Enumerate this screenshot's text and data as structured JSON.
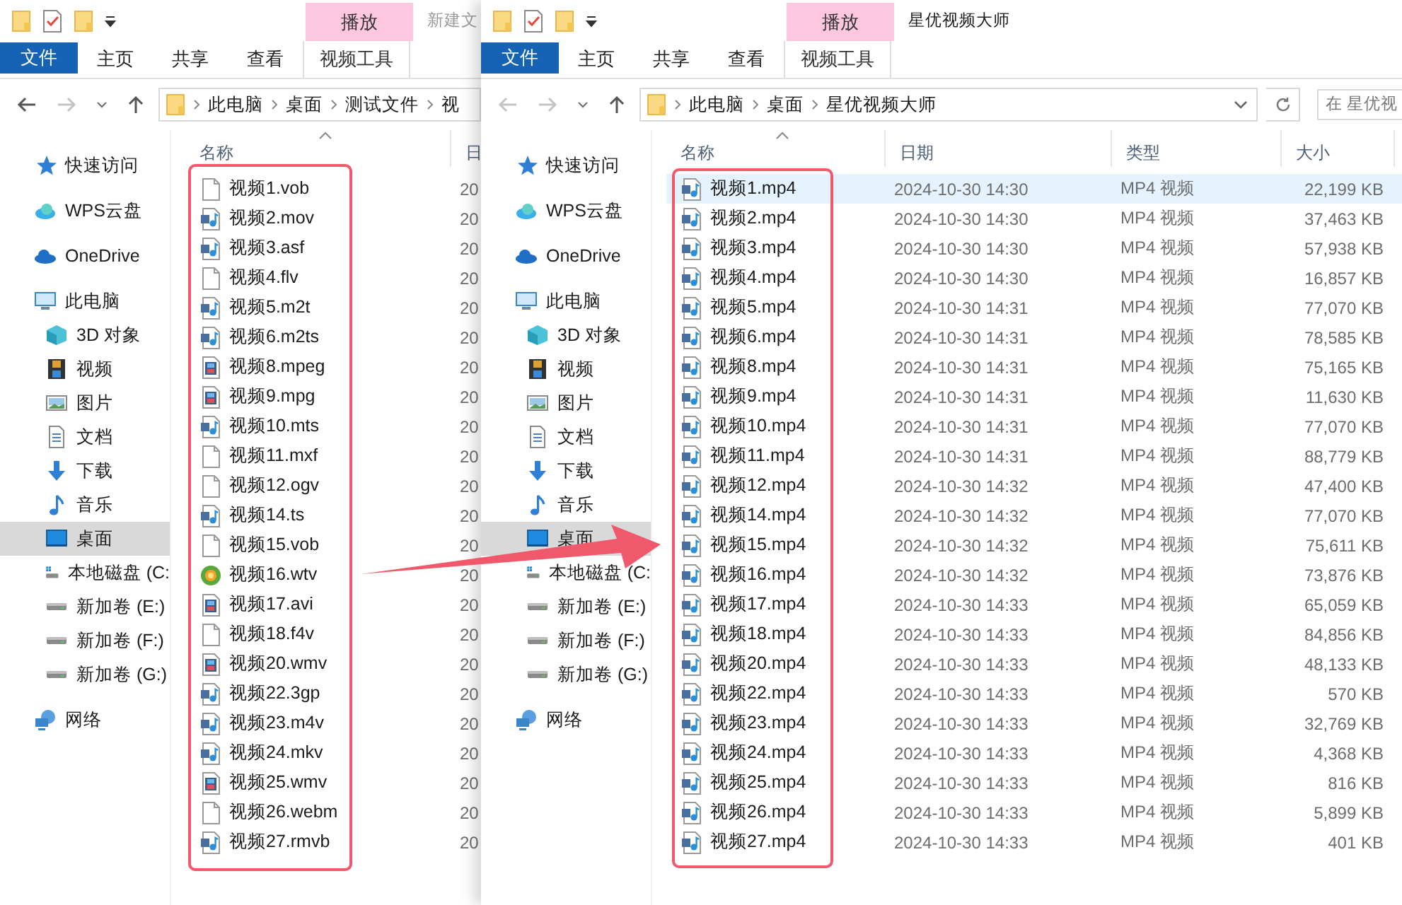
{
  "windows": [
    {
      "title": "新建文",
      "active": false,
      "context_tab": "播放",
      "ribbon_tabs": [
        {
          "label": "文件",
          "kind": "file"
        },
        {
          "label": "主页",
          "kind": "tab"
        },
        {
          "label": "共享",
          "kind": "tab"
        },
        {
          "label": "查看",
          "kind": "tab"
        },
        {
          "label": "视频工具",
          "kind": "context"
        }
      ],
      "nav_buttons": [
        {
          "kind": "back",
          "disabled": false
        },
        {
          "kind": "forward",
          "disabled": true
        },
        {
          "kind": "recent",
          "disabled": false
        },
        {
          "kind": "up",
          "disabled": false
        }
      ],
      "address": [
        "此电脑",
        "桌面",
        "测试文件",
        "视"
      ],
      "columns": [
        {
          "label": "名称",
          "kind": "name",
          "sorted": true
        },
        {
          "label": "日",
          "kind": "date",
          "sorted": false
        }
      ],
      "nav": [
        {
          "label": "快速访问",
          "kind": "star",
          "selected": false
        },
        {
          "label": "WPS云盘",
          "kind": "wps",
          "selected": false
        },
        {
          "label": "OneDrive",
          "kind": "onedrive",
          "selected": false
        },
        {
          "label": "此电脑",
          "kind": "pc",
          "selected": false,
          "children": [
            {
              "label": "3D 对象",
              "kind": "cube",
              "selected": false
            },
            {
              "label": "视频",
              "kind": "film",
              "selected": false
            },
            {
              "label": "图片",
              "kind": "picture",
              "selected": false
            },
            {
              "label": "文档",
              "kind": "doc",
              "selected": false
            },
            {
              "label": "下载",
              "kind": "download",
              "selected": false
            },
            {
              "label": "音乐",
              "kind": "music",
              "selected": false
            },
            {
              "label": "桌面",
              "kind": "desktop",
              "selected": true
            },
            {
              "label": "本地磁盘 (C:",
              "kind": "windrive",
              "selected": false
            },
            {
              "label": "新加卷 (E:)",
              "kind": "drive",
              "selected": false
            },
            {
              "label": "新加卷 (F:)",
              "kind": "drive",
              "selected": false
            },
            {
              "label": "新加卷 (G:)",
              "kind": "drive",
              "selected": false
            }
          ]
        },
        {
          "label": "网络",
          "kind": "network",
          "selected": false
        }
      ],
      "files": [
        {
          "name": "视频1.vob",
          "kind": "blank",
          "selected": false,
          "date": "20"
        },
        {
          "name": "视频2.mov",
          "kind": "media",
          "selected": false,
          "date": "20"
        },
        {
          "name": "视频3.asf",
          "kind": "media",
          "selected": false,
          "date": "20"
        },
        {
          "name": "视频4.flv",
          "kind": "blank",
          "selected": false,
          "date": "20"
        },
        {
          "name": "视频5.m2t",
          "kind": "media",
          "selected": false,
          "date": "20"
        },
        {
          "name": "视频6.m2ts",
          "kind": "media",
          "selected": false,
          "date": "20"
        },
        {
          "name": "视频8.mpeg",
          "kind": "film",
          "selected": false,
          "date": "20"
        },
        {
          "name": "视频9.mpg",
          "kind": "film",
          "selected": false,
          "date": "20"
        },
        {
          "name": "视频10.mts",
          "kind": "media",
          "selected": false,
          "date": "20"
        },
        {
          "name": "视频11.mxf",
          "kind": "blank",
          "selected": false,
          "date": "20"
        },
        {
          "name": "视频12.ogv",
          "kind": "blank",
          "selected": false,
          "date": "20"
        },
        {
          "name": "视频14.ts",
          "kind": "media",
          "selected": false,
          "date": "20"
        },
        {
          "name": "视频15.vob",
          "kind": "blank",
          "selected": false,
          "date": "20"
        },
        {
          "name": "视频16.wtv",
          "kind": "orb",
          "selected": false,
          "date": "20"
        },
        {
          "name": "视频17.avi",
          "kind": "film",
          "selected": false,
          "date": "20"
        },
        {
          "name": "视频18.f4v",
          "kind": "blank",
          "selected": false,
          "date": "20"
        },
        {
          "name": "视频20.wmv",
          "kind": "film",
          "selected": false,
          "date": "20"
        },
        {
          "name": "视频22.3gp",
          "kind": "media",
          "selected": false,
          "date": "20"
        },
        {
          "name": "视频23.m4v",
          "kind": "media",
          "selected": false,
          "date": "20"
        },
        {
          "name": "视频24.mkv",
          "kind": "media",
          "selected": false,
          "date": "20"
        },
        {
          "name": "视频25.wmv",
          "kind": "film",
          "selected": false,
          "date": "20"
        },
        {
          "name": "视频26.webm",
          "kind": "blank",
          "selected": false,
          "date": "20"
        },
        {
          "name": "视频27.rmvb",
          "kind": "media",
          "selected": false,
          "date": "20"
        }
      ]
    },
    {
      "title": "星优视频大师",
      "active": true,
      "context_tab": "播放",
      "ribbon_tabs": [
        {
          "label": "文件",
          "kind": "file"
        },
        {
          "label": "主页",
          "kind": "tab"
        },
        {
          "label": "共享",
          "kind": "tab"
        },
        {
          "label": "查看",
          "kind": "tab"
        },
        {
          "label": "视频工具",
          "kind": "context"
        }
      ],
      "nav_buttons": [
        {
          "kind": "back",
          "disabled": true
        },
        {
          "kind": "forward",
          "disabled": true
        },
        {
          "kind": "recent",
          "disabled": false
        },
        {
          "kind": "up",
          "disabled": false
        }
      ],
      "address": [
        "此电脑",
        "桌面",
        "星优视频大师"
      ],
      "search": {
        "placeholder": "在 星优视"
      },
      "columns": [
        {
          "label": "名称",
          "kind": "name",
          "sorted": true
        },
        {
          "label": "日期",
          "kind": "date",
          "sorted": false
        },
        {
          "label": "类型",
          "kind": "type",
          "sorted": false
        },
        {
          "label": "大小",
          "kind": "size",
          "sorted": false
        }
      ],
      "nav": [
        {
          "label": "快速访问",
          "kind": "star",
          "selected": false
        },
        {
          "label": "WPS云盘",
          "kind": "wps",
          "selected": false
        },
        {
          "label": "OneDrive",
          "kind": "onedrive",
          "selected": false
        },
        {
          "label": "此电脑",
          "kind": "pc",
          "selected": false,
          "children": [
            {
              "label": "3D 对象",
              "kind": "cube",
              "selected": false
            },
            {
              "label": "视频",
              "kind": "film",
              "selected": false
            },
            {
              "label": "图片",
              "kind": "picture",
              "selected": false
            },
            {
              "label": "文档",
              "kind": "doc",
              "selected": false
            },
            {
              "label": "下载",
              "kind": "download",
              "selected": false
            },
            {
              "label": "音乐",
              "kind": "music",
              "selected": false
            },
            {
              "label": "桌面",
              "kind": "desktop",
              "selected": true
            },
            {
              "label": "本地磁盘 (C:",
              "kind": "windrive",
              "selected": false
            },
            {
              "label": "新加卷 (E:)",
              "kind": "drive",
              "selected": false
            },
            {
              "label": "新加卷 (F:)",
              "kind": "drive",
              "selected": false
            },
            {
              "label": "新加卷 (G:)",
              "kind": "drive",
              "selected": false
            }
          ]
        },
        {
          "label": "网络",
          "kind": "network",
          "selected": false
        }
      ],
      "files": [
        {
          "name": "视频1.mp4",
          "kind": "media",
          "selected": true,
          "date": "2024-10-30 14:30",
          "type": "MP4 视频",
          "size": "22,199 KB"
        },
        {
          "name": "视频2.mp4",
          "kind": "media",
          "selected": false,
          "date": "2024-10-30 14:30",
          "type": "MP4 视频",
          "size": "37,463 KB"
        },
        {
          "name": "视频3.mp4",
          "kind": "media",
          "selected": false,
          "date": "2024-10-30 14:30",
          "type": "MP4 视频",
          "size": "57,938 KB"
        },
        {
          "name": "视频4.mp4",
          "kind": "media",
          "selected": false,
          "date": "2024-10-30 14:30",
          "type": "MP4 视频",
          "size": "16,857 KB"
        },
        {
          "name": "视频5.mp4",
          "kind": "media",
          "selected": false,
          "date": "2024-10-30 14:31",
          "type": "MP4 视频",
          "size": "77,070 KB"
        },
        {
          "name": "视频6.mp4",
          "kind": "media",
          "selected": false,
          "date": "2024-10-30 14:31",
          "type": "MP4 视频",
          "size": "78,585 KB"
        },
        {
          "name": "视频8.mp4",
          "kind": "media",
          "selected": false,
          "date": "2024-10-30 14:31",
          "type": "MP4 视频",
          "size": "75,165 KB"
        },
        {
          "name": "视频9.mp4",
          "kind": "media",
          "selected": false,
          "date": "2024-10-30 14:31",
          "type": "MP4 视频",
          "size": "11,630 KB"
        },
        {
          "name": "视频10.mp4",
          "kind": "media",
          "selected": false,
          "date": "2024-10-30 14:31",
          "type": "MP4 视频",
          "size": "77,070 KB"
        },
        {
          "name": "视频11.mp4",
          "kind": "media",
          "selected": false,
          "date": "2024-10-30 14:31",
          "type": "MP4 视频",
          "size": "88,779 KB"
        },
        {
          "name": "视频12.mp4",
          "kind": "media",
          "selected": false,
          "date": "2024-10-30 14:32",
          "type": "MP4 视频",
          "size": "47,400 KB"
        },
        {
          "name": "视频14.mp4",
          "kind": "media",
          "selected": false,
          "date": "2024-10-30 14:32",
          "type": "MP4 视频",
          "size": "77,070 KB"
        },
        {
          "name": "视频15.mp4",
          "kind": "media",
          "selected": false,
          "date": "2024-10-30 14:32",
          "type": "MP4 视频",
          "size": "75,611 KB"
        },
        {
          "name": "视频16.mp4",
          "kind": "media",
          "selected": false,
          "date": "2024-10-30 14:32",
          "type": "MP4 视频",
          "size": "73,876 KB"
        },
        {
          "name": "视频17.mp4",
          "kind": "media",
          "selected": false,
          "date": "2024-10-30 14:33",
          "type": "MP4 视频",
          "size": "65,059 KB"
        },
        {
          "name": "视频18.mp4",
          "kind": "media",
          "selected": false,
          "date": "2024-10-30 14:33",
          "type": "MP4 视频",
          "size": "84,856 KB"
        },
        {
          "name": "视频20.mp4",
          "kind": "media",
          "selected": false,
          "date": "2024-10-30 14:33",
          "type": "MP4 视频",
          "size": "48,133 KB"
        },
        {
          "name": "视频22.mp4",
          "kind": "media",
          "selected": false,
          "date": "2024-10-30 14:33",
          "type": "MP4 视频",
          "size": "570 KB"
        },
        {
          "name": "视频23.mp4",
          "kind": "media",
          "selected": false,
          "date": "2024-10-30 14:33",
          "type": "MP4 视频",
          "size": "32,769 KB"
        },
        {
          "name": "视频24.mp4",
          "kind": "media",
          "selected": false,
          "date": "2024-10-30 14:33",
          "type": "MP4 视频",
          "size": "4,368 KB"
        },
        {
          "name": "视频25.mp4",
          "kind": "media",
          "selected": false,
          "date": "2024-10-30 14:33",
          "type": "MP4 视频",
          "size": "816 KB"
        },
        {
          "name": "视频26.mp4",
          "kind": "media",
          "selected": false,
          "date": "2024-10-30 14:33",
          "type": "MP4 视频",
          "size": "5,899 KB"
        },
        {
          "name": "视频27.mp4",
          "kind": "media",
          "selected": false,
          "date": "2024-10-30 14:33",
          "type": "MP4 视频",
          "size": "401 KB"
        }
      ]
    }
  ]
}
